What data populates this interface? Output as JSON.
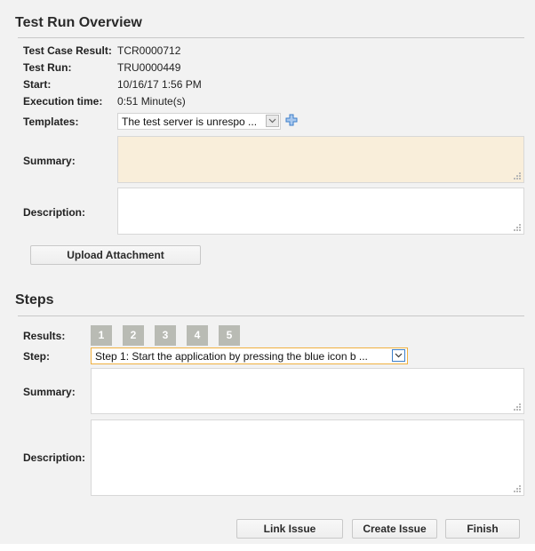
{
  "overview": {
    "title": "Test Run Overview",
    "fields": [
      {
        "label": "Test Case Result:",
        "value": "TCR0000712"
      },
      {
        "label": "Test Run:",
        "value": "TRU0000449"
      },
      {
        "label": "Start:",
        "value": "10/16/17 1:56 PM"
      },
      {
        "label": "Execution time:",
        "value": "0:51 Minute(s)"
      }
    ],
    "templates_label": "Templates:",
    "templates_value": "The test server is unrespo ...",
    "summary_label": "Summary:",
    "summary_value": "",
    "description_label": "Description:",
    "description_value": "",
    "upload_button": "Upload Attachment",
    "colors": {
      "summary_bg": "#f9eeda",
      "add_icon": "#3d7fc9"
    }
  },
  "steps": {
    "title": "Steps",
    "results_label": "Results:",
    "results": [
      "1",
      "2",
      "3",
      "4",
      "5"
    ],
    "step_label": "Step:",
    "step_value": "Step 1: Start the application by pressing the blue icon b ...",
    "summary_label": "Summary:",
    "summary_value": "",
    "description_label": "Description:",
    "description_value": "",
    "colors": {
      "result_box": "#b9bbb4",
      "step_select_border": "#f0b040"
    }
  },
  "footer": {
    "link_issue": "Link Issue",
    "create_issue": "Create Issue",
    "finish": "Finish"
  }
}
